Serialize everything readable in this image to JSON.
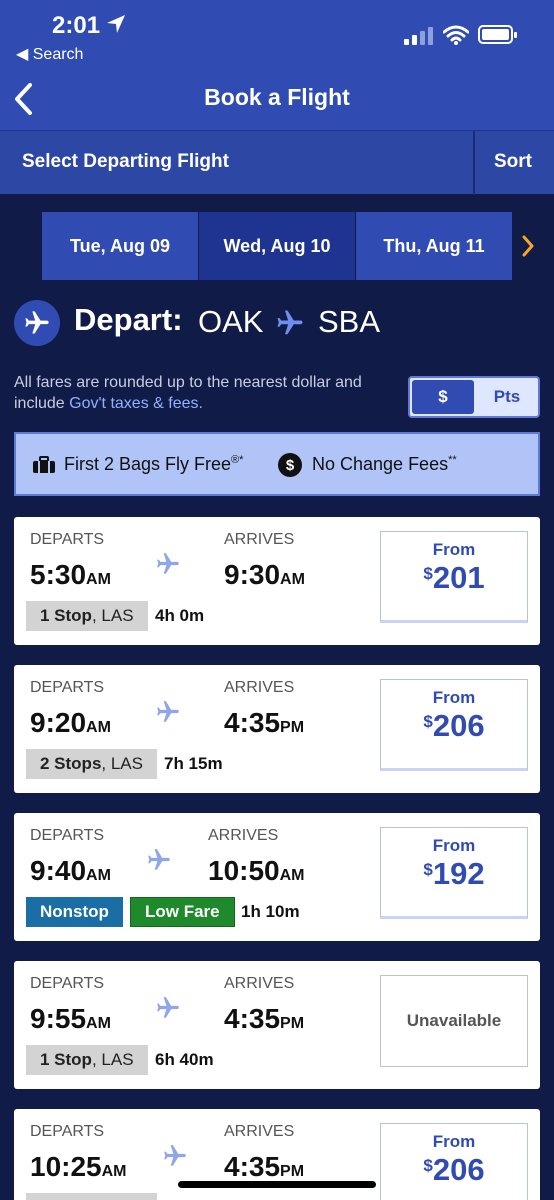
{
  "status": {
    "time": "2:01",
    "back_app": "◀ Search"
  },
  "nav": {
    "title": "Book a Flight"
  },
  "select": {
    "title": "Select Departing Flight",
    "sort": "Sort"
  },
  "dates": [
    {
      "label": "Tue, Aug 09",
      "selected": false
    },
    {
      "label": "Wed, Aug 10",
      "selected": true
    },
    {
      "label": "Thu, Aug 11",
      "selected": false
    }
  ],
  "route": {
    "depart_label": "Depart:",
    "origin": "OAK",
    "destination": "SBA"
  },
  "fare_note": {
    "text": "All fares are rounded up to the nearest dollar and include ",
    "link": "Gov't taxes & fees."
  },
  "currency": {
    "dollar": "$",
    "points": "Pts",
    "selected": "$"
  },
  "promo": {
    "bags": "First 2 Bags Fly Free",
    "bags_mark": "®*",
    "no_change": "No Change Fees",
    "no_change_mark": "**"
  },
  "labels": {
    "departs": "DEPARTS",
    "arrives": "ARRIVES",
    "from": "From"
  },
  "flights": [
    {
      "dep_time": "5:30",
      "dep_ampm": "AM",
      "arr_time": "9:30",
      "arr_ampm": "AM",
      "stops": "1 Stop",
      "via": ", LAS",
      "duration": "4h 0m",
      "price": "201"
    },
    {
      "dep_time": "9:20",
      "dep_ampm": "AM",
      "arr_time": "4:35",
      "arr_ampm": "PM",
      "stops": "2 Stops",
      "via": ", LAS",
      "duration": "7h 15m",
      "price": "206"
    },
    {
      "dep_time": "9:40",
      "dep_ampm": "AM",
      "arr_time": "10:50",
      "arr_ampm": "AM",
      "nonstop": "Nonstop",
      "low_fare": "Low Fare",
      "duration": "1h 10m",
      "price": "192"
    },
    {
      "dep_time": "9:55",
      "dep_ampm": "AM",
      "arr_time": "4:35",
      "arr_ampm": "PM",
      "stops": "1 Stop",
      "via": ", LAS",
      "duration": "6h 40m",
      "unavailable": "Unavailable"
    },
    {
      "dep_time": "10:25",
      "dep_ampm": "AM",
      "arr_time": "4:35",
      "arr_ampm": "PM",
      "price": "206"
    }
  ],
  "colors": {
    "brand_blue": "#304cb2",
    "background": "#111b47",
    "promo": "#b1c4f8",
    "nonstop": "#1a6ea6",
    "low_fare": "#1e8a2c",
    "chevron": "#f5a623"
  },
  "icons": [
    "location-arrow-icon",
    "signal-icon",
    "wifi-icon",
    "battery-icon",
    "back-chevron-icon",
    "chevron-right-icon",
    "plane-icon",
    "bag-icon",
    "dollar-circle-icon"
  ]
}
